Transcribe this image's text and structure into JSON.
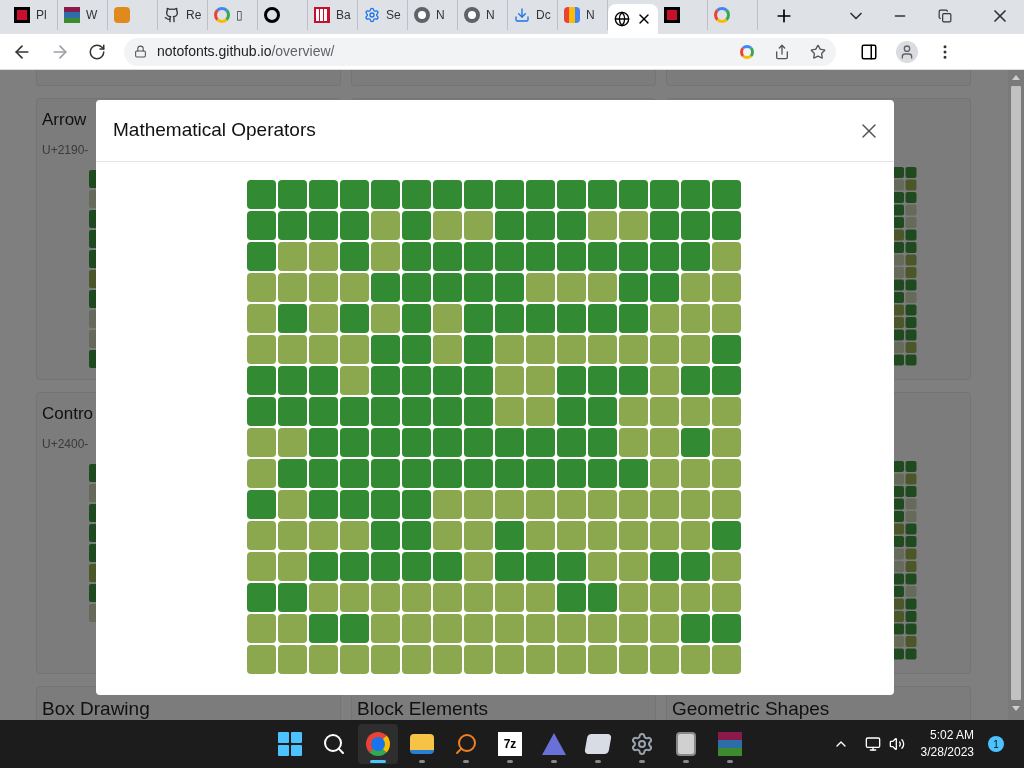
{
  "browser": {
    "tabs": [
      {
        "title": "Pl",
        "selected": false
      },
      {
        "title": "W",
        "selected": false
      },
      {
        "selected": false
      },
      {
        "title": "Re",
        "selected": false
      },
      {
        "title": "▯",
        "selected": false
      },
      {
        "selected": false
      },
      {
        "title": "Ba",
        "selected": false
      },
      {
        "title": "Se",
        "selected": false
      },
      {
        "title": "N",
        "selected": false
      },
      {
        "title": "N",
        "selected": false
      },
      {
        "title": "Dc",
        "selected": false
      },
      {
        "title": "N",
        "selected": false
      },
      {
        "selected": true
      },
      {
        "selected": false
      },
      {
        "selected": false
      }
    ],
    "address": {
      "host": "notofonts.github.io",
      "path": "/overview/"
    }
  },
  "page": {
    "cards": [
      {
        "title": "Arrow",
        "range": "U+2190-"
      },
      {
        "title": "Contro",
        "range": "U+2400-"
      },
      {
        "title": "Box Drawing"
      },
      {
        "title": "Block Elements"
      },
      {
        "title": "Geometric Shapes"
      }
    ]
  },
  "modal": {
    "title": "Mathematical Operators",
    "grid": [
      {
        "cells": [
          {
            "color": "#328a33"
          },
          {
            "color": "#328a33"
          },
          {
            "color": "#328a33"
          },
          {
            "color": "#328a33"
          },
          {
            "color": "#328a33"
          },
          {
            "color": "#328a33"
          },
          {
            "color": "#328a33"
          },
          {
            "color": "#328a33"
          },
          {
            "color": "#328a33"
          },
          {
            "color": "#328a33"
          },
          {
            "color": "#328a33"
          },
          {
            "color": "#328a33"
          },
          {
            "color": "#328a33"
          },
          {
            "color": "#328a33"
          },
          {
            "color": "#328a33"
          },
          {
            "color": "#328a33"
          }
        ]
      },
      {
        "cells": [
          {
            "color": "#328a33"
          },
          {
            "color": "#328a33"
          },
          {
            "color": "#328a33"
          },
          {
            "color": "#328a33"
          },
          {
            "color": "#8ba84f"
          },
          {
            "color": "#328a33"
          },
          {
            "color": "#8ba84f"
          },
          {
            "color": "#8ba84f"
          },
          {
            "color": "#328a33"
          },
          {
            "color": "#328a33"
          },
          {
            "color": "#328a33"
          },
          {
            "color": "#8ba84f"
          },
          {
            "color": "#8ba84f"
          },
          {
            "color": "#328a33"
          },
          {
            "color": "#328a33"
          },
          {
            "color": "#328a33"
          }
        ]
      },
      {
        "cells": [
          {
            "color": "#328a33"
          },
          {
            "color": "#8ba84f"
          },
          {
            "color": "#8ba84f"
          },
          {
            "color": "#328a33"
          },
          {
            "color": "#8ba84f"
          },
          {
            "color": "#328a33"
          },
          {
            "color": "#328a33"
          },
          {
            "color": "#328a33"
          },
          {
            "color": "#328a33"
          },
          {
            "color": "#328a33"
          },
          {
            "color": "#328a33"
          },
          {
            "color": "#328a33"
          },
          {
            "color": "#328a33"
          },
          {
            "color": "#328a33"
          },
          {
            "color": "#328a33"
          },
          {
            "color": "#8ba84f"
          }
        ]
      },
      {
        "cells": [
          {
            "color": "#8ba84f"
          },
          {
            "color": "#8ba84f"
          },
          {
            "color": "#8ba84f"
          },
          {
            "color": "#8ba84f"
          },
          {
            "color": "#328a33"
          },
          {
            "color": "#328a33"
          },
          {
            "color": "#328a33"
          },
          {
            "color": "#328a33"
          },
          {
            "color": "#328a33"
          },
          {
            "color": "#8ba84f"
          },
          {
            "color": "#8ba84f"
          },
          {
            "color": "#8ba84f"
          },
          {
            "color": "#328a33"
          },
          {
            "color": "#328a33"
          },
          {
            "color": "#8ba84f"
          },
          {
            "color": "#8ba84f"
          }
        ]
      },
      {
        "cells": [
          {
            "color": "#8ba84f"
          },
          {
            "color": "#328a33"
          },
          {
            "color": "#8ba84f"
          },
          {
            "color": "#328a33"
          },
          {
            "color": "#8ba84f"
          },
          {
            "color": "#328a33"
          },
          {
            "color": "#8ba84f"
          },
          {
            "color": "#328a33"
          },
          {
            "color": "#328a33"
          },
          {
            "color": "#328a33"
          },
          {
            "color": "#328a33"
          },
          {
            "color": "#328a33"
          },
          {
            "color": "#328a33"
          },
          {
            "color": "#8ba84f"
          },
          {
            "color": "#8ba84f"
          },
          {
            "color": "#8ba84f"
          }
        ]
      },
      {
        "cells": [
          {
            "color": "#8ba84f"
          },
          {
            "color": "#8ba84f"
          },
          {
            "color": "#8ba84f"
          },
          {
            "color": "#8ba84f"
          },
          {
            "color": "#328a33"
          },
          {
            "color": "#328a33"
          },
          {
            "color": "#8ba84f"
          },
          {
            "color": "#328a33"
          },
          {
            "color": "#8ba84f"
          },
          {
            "color": "#8ba84f"
          },
          {
            "color": "#8ba84f"
          },
          {
            "color": "#8ba84f"
          },
          {
            "color": "#8ba84f"
          },
          {
            "color": "#8ba84f"
          },
          {
            "color": "#8ba84f"
          },
          {
            "color": "#328a33"
          }
        ]
      },
      {
        "cells": [
          {
            "color": "#328a33"
          },
          {
            "color": "#328a33"
          },
          {
            "color": "#328a33"
          },
          {
            "color": "#8ba84f"
          },
          {
            "color": "#328a33"
          },
          {
            "color": "#328a33"
          },
          {
            "color": "#328a33"
          },
          {
            "color": "#328a33"
          },
          {
            "color": "#8ba84f"
          },
          {
            "color": "#8ba84f"
          },
          {
            "color": "#328a33"
          },
          {
            "color": "#328a33"
          },
          {
            "color": "#328a33"
          },
          {
            "color": "#8ba84f"
          },
          {
            "color": "#328a33"
          },
          {
            "color": "#328a33"
          }
        ]
      },
      {
        "cells": [
          {
            "color": "#328a33"
          },
          {
            "color": "#328a33"
          },
          {
            "color": "#328a33"
          },
          {
            "color": "#328a33"
          },
          {
            "color": "#328a33"
          },
          {
            "color": "#328a33"
          },
          {
            "color": "#328a33"
          },
          {
            "color": "#328a33"
          },
          {
            "color": "#8ba84f"
          },
          {
            "color": "#8ba84f"
          },
          {
            "color": "#328a33"
          },
          {
            "color": "#328a33"
          },
          {
            "color": "#8ba84f"
          },
          {
            "color": "#8ba84f"
          },
          {
            "color": "#8ba84f"
          },
          {
            "color": "#8ba84f"
          }
        ]
      },
      {
        "cells": [
          {
            "color": "#8ba84f"
          },
          {
            "color": "#8ba84f"
          },
          {
            "color": "#328a33"
          },
          {
            "color": "#328a33"
          },
          {
            "color": "#328a33"
          },
          {
            "color": "#328a33"
          },
          {
            "color": "#328a33"
          },
          {
            "color": "#328a33"
          },
          {
            "color": "#328a33"
          },
          {
            "color": "#328a33"
          },
          {
            "color": "#328a33"
          },
          {
            "color": "#328a33"
          },
          {
            "color": "#8ba84f"
          },
          {
            "color": "#8ba84f"
          },
          {
            "color": "#328a33"
          },
          {
            "color": "#8ba84f"
          }
        ]
      },
      {
        "cells": [
          {
            "color": "#8ba84f"
          },
          {
            "color": "#328a33"
          },
          {
            "color": "#328a33"
          },
          {
            "color": "#328a33"
          },
          {
            "color": "#328a33"
          },
          {
            "color": "#328a33"
          },
          {
            "color": "#328a33"
          },
          {
            "color": "#328a33"
          },
          {
            "color": "#328a33"
          },
          {
            "color": "#328a33"
          },
          {
            "color": "#328a33"
          },
          {
            "color": "#328a33"
          },
          {
            "color": "#328a33"
          },
          {
            "color": "#8ba84f"
          },
          {
            "color": "#8ba84f"
          },
          {
            "color": "#8ba84f"
          }
        ]
      },
      {
        "cells": [
          {
            "color": "#328a33"
          },
          {
            "color": "#8ba84f"
          },
          {
            "color": "#328a33"
          },
          {
            "color": "#328a33"
          },
          {
            "color": "#328a33"
          },
          {
            "color": "#328a33"
          },
          {
            "color": "#8ba84f"
          },
          {
            "color": "#8ba84f"
          },
          {
            "color": "#8ba84f"
          },
          {
            "color": "#8ba84f"
          },
          {
            "color": "#8ba84f"
          },
          {
            "color": "#8ba84f"
          },
          {
            "color": "#8ba84f"
          },
          {
            "color": "#8ba84f"
          },
          {
            "color": "#8ba84f"
          },
          {
            "color": "#8ba84f"
          }
        ]
      },
      {
        "cells": [
          {
            "color": "#8ba84f"
          },
          {
            "color": "#8ba84f"
          },
          {
            "color": "#8ba84f"
          },
          {
            "color": "#8ba84f"
          },
          {
            "color": "#328a33"
          },
          {
            "color": "#328a33"
          },
          {
            "color": "#8ba84f"
          },
          {
            "color": "#8ba84f"
          },
          {
            "color": "#328a33"
          },
          {
            "color": "#8ba84f"
          },
          {
            "color": "#8ba84f"
          },
          {
            "color": "#8ba84f"
          },
          {
            "color": "#8ba84f"
          },
          {
            "color": "#8ba84f"
          },
          {
            "color": "#8ba84f"
          },
          {
            "color": "#328a33"
          }
        ]
      },
      {
        "cells": [
          {
            "color": "#8ba84f"
          },
          {
            "color": "#8ba84f"
          },
          {
            "color": "#328a33"
          },
          {
            "color": "#328a33"
          },
          {
            "color": "#328a33"
          },
          {
            "color": "#328a33"
          },
          {
            "color": "#328a33"
          },
          {
            "color": "#8ba84f"
          },
          {
            "color": "#328a33"
          },
          {
            "color": "#328a33"
          },
          {
            "color": "#328a33"
          },
          {
            "color": "#8ba84f"
          },
          {
            "color": "#8ba84f"
          },
          {
            "color": "#328a33"
          },
          {
            "color": "#328a33"
          },
          {
            "color": "#8ba84f"
          }
        ]
      },
      {
        "cells": [
          {
            "color": "#328a33"
          },
          {
            "color": "#328a33"
          },
          {
            "color": "#8ba84f"
          },
          {
            "color": "#8ba84f"
          },
          {
            "color": "#8ba84f"
          },
          {
            "color": "#8ba84f"
          },
          {
            "color": "#8ba84f"
          },
          {
            "color": "#8ba84f"
          },
          {
            "color": "#8ba84f"
          },
          {
            "color": "#8ba84f"
          },
          {
            "color": "#328a33"
          },
          {
            "color": "#328a33"
          },
          {
            "color": "#8ba84f"
          },
          {
            "color": "#8ba84f"
          },
          {
            "color": "#8ba84f"
          },
          {
            "color": "#8ba84f"
          }
        ]
      },
      {
        "cells": [
          {
            "color": "#8ba84f"
          },
          {
            "color": "#8ba84f"
          },
          {
            "color": "#328a33"
          },
          {
            "color": "#328a33"
          },
          {
            "color": "#8ba84f"
          },
          {
            "color": "#8ba84f"
          },
          {
            "color": "#8ba84f"
          },
          {
            "color": "#8ba84f"
          },
          {
            "color": "#8ba84f"
          },
          {
            "color": "#8ba84f"
          },
          {
            "color": "#8ba84f"
          },
          {
            "color": "#8ba84f"
          },
          {
            "color": "#8ba84f"
          },
          {
            "color": "#8ba84f"
          },
          {
            "color": "#328a33"
          },
          {
            "color": "#328a33"
          }
        ]
      },
      {
        "cells": [
          {
            "color": "#8ba84f"
          },
          {
            "color": "#8ba84f"
          },
          {
            "color": "#8ba84f"
          },
          {
            "color": "#8ba84f"
          },
          {
            "color": "#8ba84f"
          },
          {
            "color": "#8ba84f"
          },
          {
            "color": "#8ba84f"
          },
          {
            "color": "#8ba84f"
          },
          {
            "color": "#8ba84f"
          },
          {
            "color": "#8ba84f"
          },
          {
            "color": "#8ba84f"
          },
          {
            "color": "#8ba84f"
          },
          {
            "color": "#8ba84f"
          },
          {
            "color": "#8ba84f"
          },
          {
            "color": "#8ba84f"
          },
          {
            "color": "#8ba84f"
          }
        ]
      }
    ]
  },
  "taskbar": {
    "apps": [
      {
        "kind": "start",
        "selected": false
      },
      {
        "kind": "search",
        "selected": false
      },
      {
        "kind": "chrome",
        "selected": true
      },
      {
        "kind": "folder",
        "selected": false
      },
      {
        "kind": "magnifier",
        "selected": false
      },
      {
        "kind": "archive",
        "label": "7z",
        "selected": false
      },
      {
        "kind": "letter",
        "selected": false
      },
      {
        "kind": "cube",
        "selected": false
      },
      {
        "kind": "gear",
        "selected": false
      },
      {
        "kind": "files",
        "selected": false
      },
      {
        "kind": "books",
        "selected": false
      }
    ],
    "time": "5:02 AM",
    "date": "3/28/2023",
    "notifications": "1"
  }
}
